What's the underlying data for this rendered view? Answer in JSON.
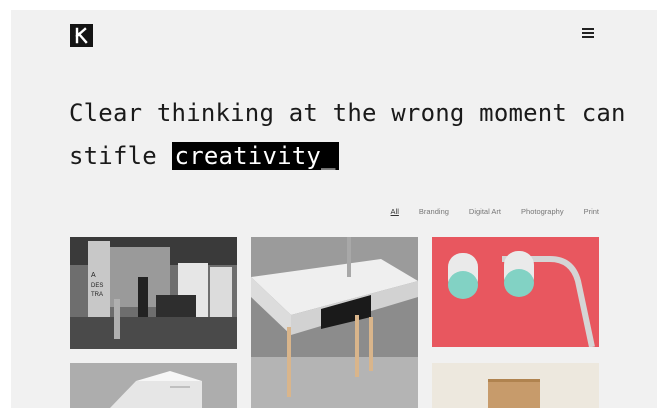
{
  "header": {
    "logo_letter": "K",
    "menu_icon": "hamburger-icon"
  },
  "hero": {
    "line1": "Clear thinking at the wrong moment can",
    "line2_prefix": "stifle ",
    "highlight": "creativity_"
  },
  "filters": [
    "All",
    "Branding",
    "Digital Art",
    "Photography",
    "Print"
  ],
  "active_filter": "All",
  "tiles": [
    {
      "name": "office-photo"
    },
    {
      "name": "desk-photo"
    },
    {
      "name": "lamp-photo"
    },
    {
      "name": "box-photo"
    },
    {
      "name": "shelf-photo"
    }
  ]
}
